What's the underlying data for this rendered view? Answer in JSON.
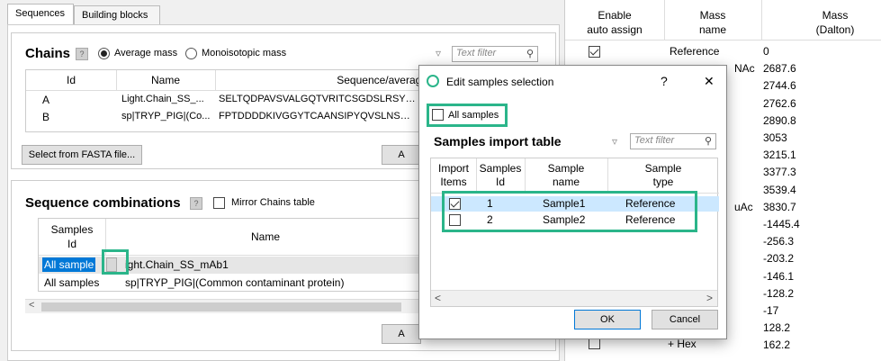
{
  "tabs": [
    "Sequences",
    "Building blocks"
  ],
  "chains": {
    "title": "Chains",
    "mass_options": [
      "Average mass",
      "Monoisotopic mass"
    ],
    "filter_placeholder": "Text filter",
    "columns": [
      "Id",
      "Name",
      "Sequence/average"
    ],
    "rows": [
      {
        "id": "A",
        "name": "Light.Chain_SS_...",
        "seq": "SELTQDPAVSVALGQTVRITCSGDSLRSY…"
      },
      {
        "id": "B",
        "name": "sp|TRYP_PIG|(Co...",
        "seq": "FPTDDDDKIVGGYTCAANSIPYQVSLNS…"
      }
    ],
    "fasta_button": "Select from FASTA file...",
    "add_button": "A"
  },
  "combinations": {
    "title": "Sequence combinations",
    "mirror_label": "Mirror Chains table",
    "columns": [
      "Samples\nId",
      "Name"
    ],
    "rows": [
      {
        "samples": "All sample",
        "name": "ight.Chain_SS_mAb1"
      },
      {
        "samples": "All samples",
        "name": "sp|TRYP_PIG|(Common contaminant protein)"
      }
    ],
    "add_button": "A"
  },
  "right_table": {
    "columns": [
      "Enable\nauto assign",
      "Mass\nname",
      "Mass\n(Dalton)"
    ],
    "first_row_name": "Reference",
    "partial_name_1": "NAc",
    "partial_name_2": "uAc",
    "last_row_name": "+ Hex",
    "masses": [
      "0",
      "2687.6",
      "2744.6",
      "2762.6",
      "2890.8",
      "3053",
      "3215.1",
      "3377.3",
      "3539.4",
      "3830.7",
      "-1445.4",
      "-256.3",
      "-203.2",
      "-146.1",
      "-128.2",
      "-17",
      "128.2",
      "162.2"
    ]
  },
  "dialog": {
    "title": "Edit samples selection",
    "help": "?",
    "close": "✕",
    "all_samples_label": "All samples",
    "table_title": "Samples import table",
    "filter_placeholder": "Text filter",
    "columns": [
      "Import\nItems",
      "Samples\nId",
      "Sample\nname",
      "Sample\ntype"
    ],
    "rows": [
      {
        "checked": true,
        "id": "1",
        "name": "Sample1",
        "type": "Reference"
      },
      {
        "checked": false,
        "id": "2",
        "name": "Sample2",
        "type": "Reference"
      }
    ],
    "ok": "OK",
    "cancel": "Cancel"
  },
  "colors": {
    "highlight": "#2bb58a",
    "selection": "#0078d7",
    "row_select": "#cce8ff"
  }
}
